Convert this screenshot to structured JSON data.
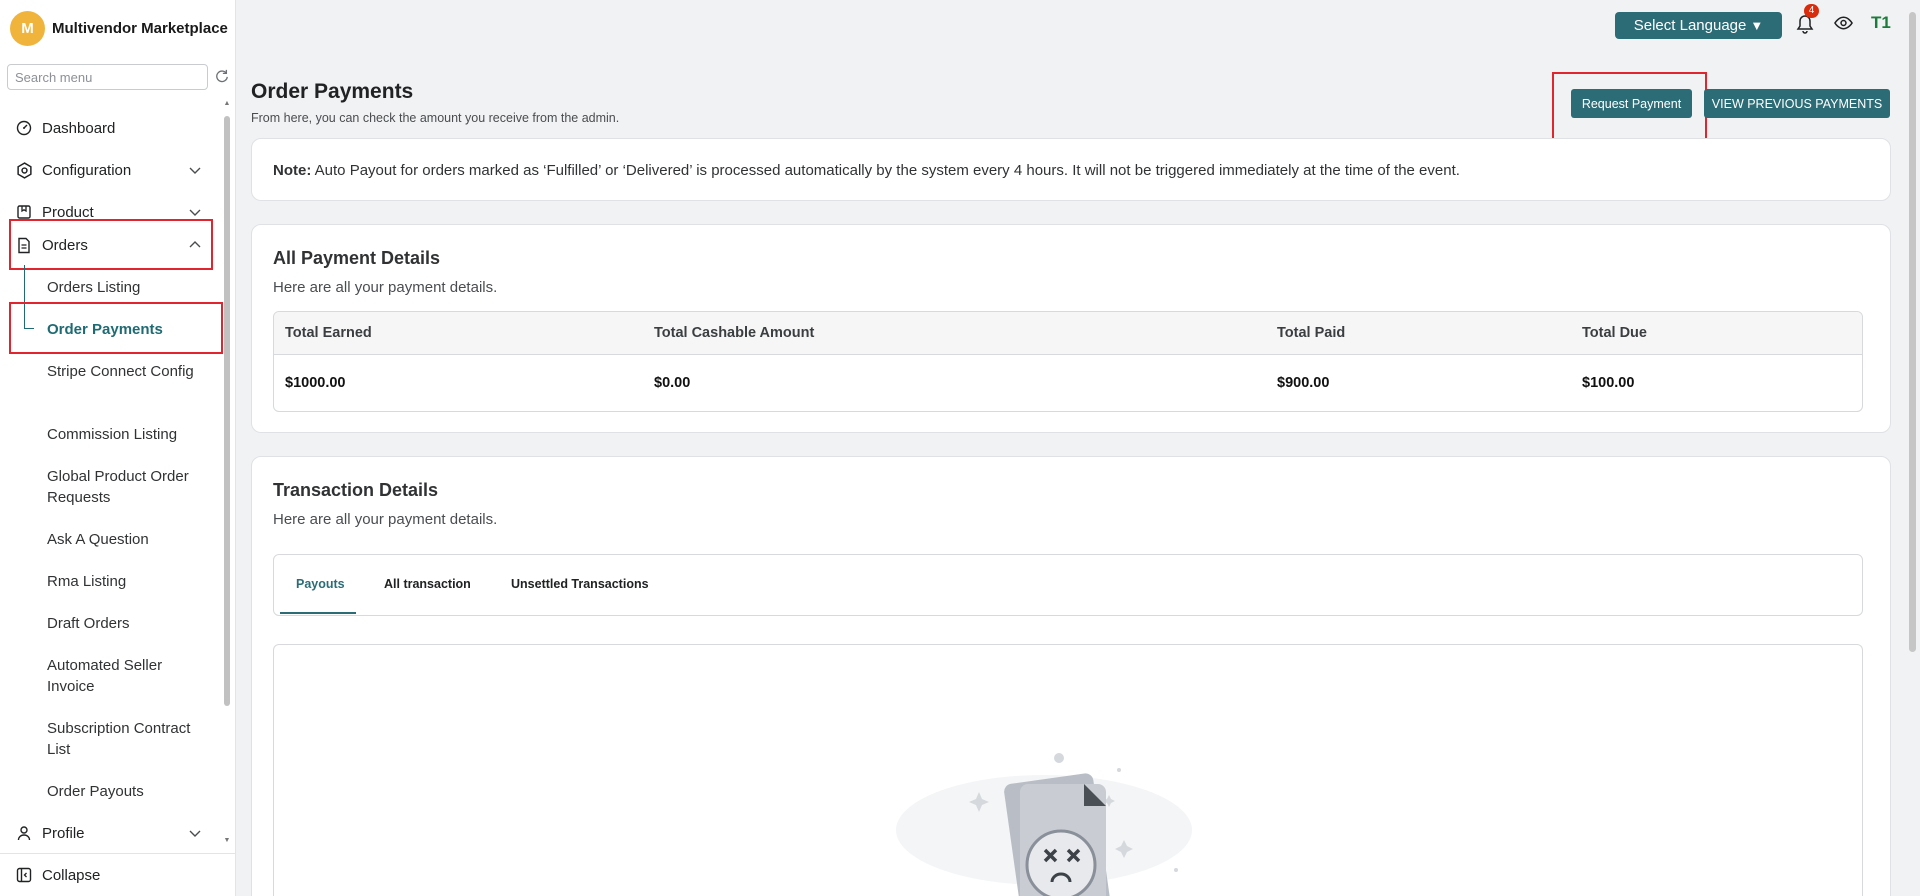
{
  "sidebar": {
    "brand_initial": "M",
    "brand_name": "Multivendor Marketplace",
    "search_placeholder": "Search menu",
    "items": [
      {
        "label": "Dashboard"
      },
      {
        "label": "Configuration"
      },
      {
        "label": "Product"
      },
      {
        "label": "Orders"
      },
      {
        "label": "Profile"
      }
    ],
    "order_subitems": [
      "Orders Listing",
      "Order Payments",
      "Stripe Connect Config",
      "Commission Listing",
      "Global Product Order Requests",
      "Ask A Question",
      "Rma Listing",
      "Draft Orders",
      "Automated Seller Invoice",
      "Subscription Contract List",
      "Order Payouts"
    ],
    "collapse_label": "Collapse"
  },
  "topbar": {
    "language_label": "Select Language",
    "notification_count": "4",
    "user_initials": "T1"
  },
  "page": {
    "title": "Order Payments",
    "subtitle": "From here, you can check the amount you receive from the admin.",
    "request_button": "Request Payment",
    "previous_button": "VIEW PREVIOUS PAYMENTS"
  },
  "note": {
    "prefix": "Note:",
    "text": " Auto Payout for orders marked as ‘Fulfilled’ or ‘Delivered’ is processed automatically by the system every 4 hours. It will not be triggered immediately at the time of the event."
  },
  "payment_details": {
    "title": "All Payment Details",
    "subtitle": "Here are all your payment details.",
    "headers": [
      "Total Earned",
      "Total Cashable Amount",
      "Total Paid",
      "Total Due"
    ],
    "values": [
      "$1000.00",
      "$0.00",
      "$900.00",
      "$100.00"
    ]
  },
  "transactions": {
    "title": "Transaction Details",
    "subtitle": "Here are all your payment details.",
    "tabs": [
      "Payouts",
      "All transaction",
      "Unsettled Transactions"
    ]
  },
  "colors": {
    "accent": "#2c6c76",
    "highlight": "#e0252e",
    "brand_avatar": "#f0b43c"
  }
}
